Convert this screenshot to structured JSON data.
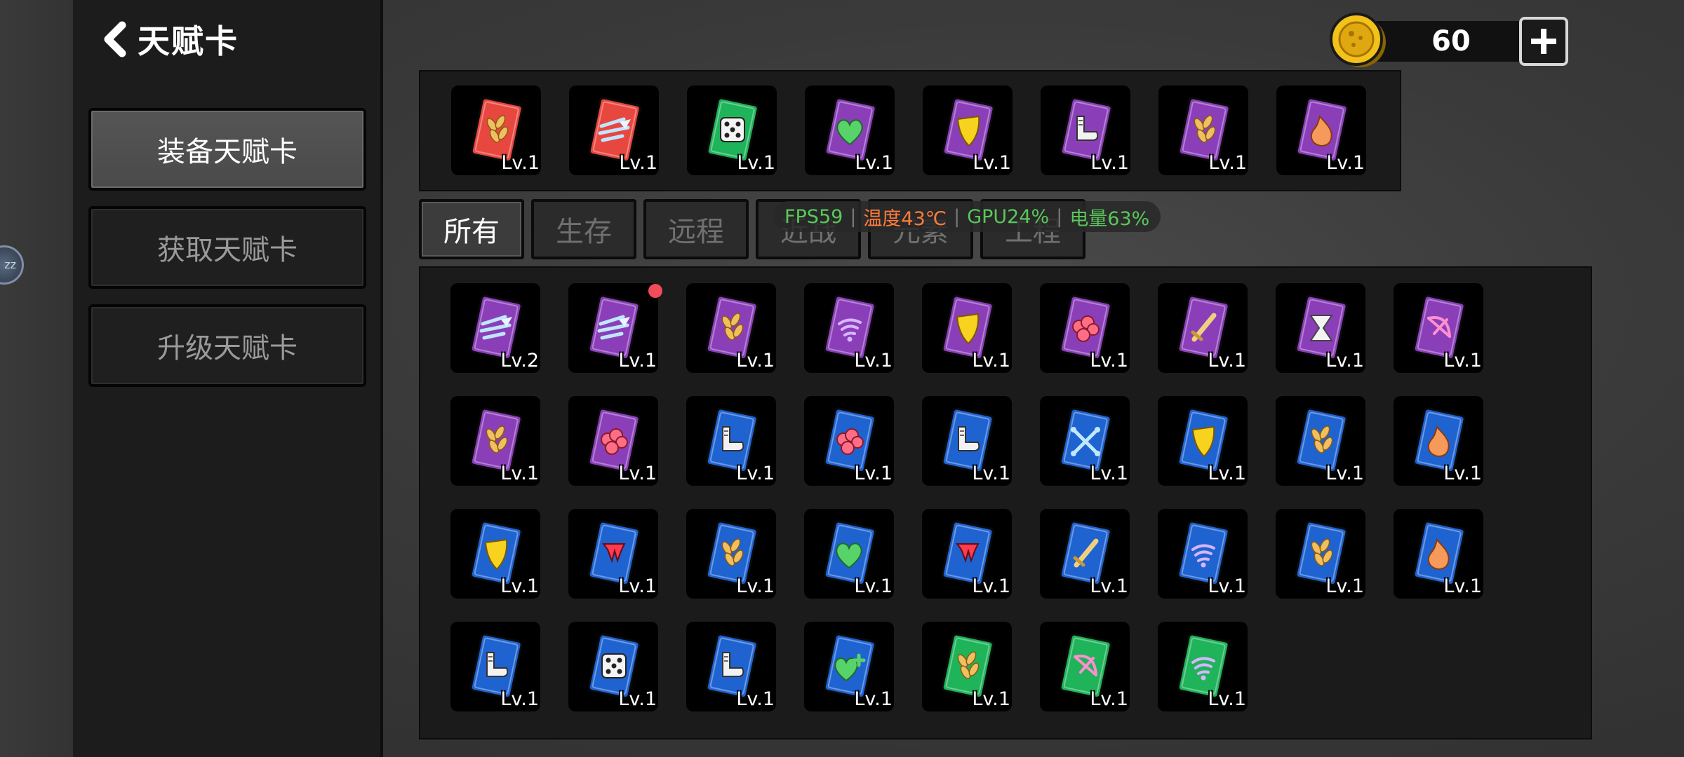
{
  "header": {
    "title": "天赋卡"
  },
  "sidebar": {
    "items": [
      {
        "label": "装备天赋卡",
        "active": true
      },
      {
        "label": "获取天赋卡",
        "active": false
      },
      {
        "label": "升级天赋卡",
        "active": false
      }
    ]
  },
  "floating_ball": {
    "label": "zz"
  },
  "currency": {
    "value": "60"
  },
  "tabs": [
    {
      "label": "所有",
      "active": true
    },
    {
      "label": "生存",
      "active": false
    },
    {
      "label": "远程",
      "active": false
    },
    {
      "label": "近战",
      "active": false
    },
    {
      "label": "元素",
      "active": false
    },
    {
      "label": "工程",
      "active": false
    }
  ],
  "overlay": {
    "fps": "FPS59",
    "temp": "温度43℃",
    "gpu": "GPU24%",
    "battery": "电量63%"
  },
  "colors": {
    "red": "#e8473f",
    "green": "#1fb35a",
    "purple": "#8a3fb8",
    "blue": "#1f63d1",
    "fps_green": "#59c85a",
    "temp_orange": "#ff7b3b"
  },
  "equipped": [
    {
      "color": "red",
      "icon": "wheat-icon",
      "level": "Lv.1"
    },
    {
      "color": "red",
      "icon": "wind-icon",
      "level": "Lv.1"
    },
    {
      "color": "green",
      "icon": "dice-icon",
      "level": "Lv.1"
    },
    {
      "color": "purple",
      "icon": "heart-icon",
      "level": "Lv.1"
    },
    {
      "color": "purple",
      "icon": "shield-icon",
      "level": "Lv.1"
    },
    {
      "color": "purple",
      "icon": "boot-icon",
      "level": "Lv.1"
    },
    {
      "color": "purple",
      "icon": "wheat-icon",
      "level": "Lv.1"
    },
    {
      "color": "purple",
      "icon": "fire-icon",
      "level": "Lv.1"
    }
  ],
  "inventory": [
    {
      "color": "purple",
      "icon": "wind-icon",
      "level": "Lv.2"
    },
    {
      "color": "purple",
      "icon": "wind-icon",
      "level": "Lv.1",
      "new": true
    },
    {
      "color": "purple",
      "icon": "wheat-icon",
      "level": "Lv.1"
    },
    {
      "color": "purple",
      "icon": "signal-icon",
      "level": "Lv.1"
    },
    {
      "color": "purple",
      "icon": "shield-icon",
      "level": "Lv.1"
    },
    {
      "color": "purple",
      "icon": "fist-icon",
      "level": "Lv.1"
    },
    {
      "color": "purple",
      "icon": "sword-icon",
      "level": "Lv.1"
    },
    {
      "color": "purple",
      "icon": "hourglass-icon",
      "level": "Lv.1"
    },
    {
      "color": "purple",
      "icon": "bow-icon",
      "level": "Lv.1"
    },
    {
      "color": "purple",
      "icon": "wheat-icon",
      "level": "Lv.1"
    },
    {
      "color": "purple",
      "icon": "fist-icon",
      "level": "Lv.1"
    },
    {
      "color": "blue",
      "icon": "boot-icon",
      "level": "Lv.1"
    },
    {
      "color": "blue",
      "icon": "fist-icon",
      "level": "Lv.1"
    },
    {
      "color": "blue",
      "icon": "boot-icon",
      "level": "Lv.1"
    },
    {
      "color": "blue",
      "icon": "crossed-bones-icon",
      "level": "Lv.1"
    },
    {
      "color": "blue",
      "icon": "shield-icon",
      "level": "Lv.1"
    },
    {
      "color": "blue",
      "icon": "wheat-icon",
      "level": "Lv.1"
    },
    {
      "color": "blue",
      "icon": "fire-icon",
      "level": "Lv.1"
    },
    {
      "color": "blue",
      "icon": "shield-icon",
      "level": "Lv.1"
    },
    {
      "color": "blue",
      "icon": "fang-icon",
      "level": "Lv.1"
    },
    {
      "color": "blue",
      "icon": "wheat-icon",
      "level": "Lv.1"
    },
    {
      "color": "blue",
      "icon": "heart-icon",
      "level": "Lv.1"
    },
    {
      "color": "blue",
      "icon": "fang-icon",
      "level": "Lv.1"
    },
    {
      "color": "blue",
      "icon": "sword-icon",
      "level": "Lv.1"
    },
    {
      "color": "blue",
      "icon": "signal-icon",
      "level": "Lv.1"
    },
    {
      "color": "blue",
      "icon": "wheat-icon",
      "level": "Lv.1"
    },
    {
      "color": "blue",
      "icon": "fire-icon",
      "level": "Lv.1"
    },
    {
      "color": "blue",
      "icon": "boot-icon",
      "level": "Lv.1"
    },
    {
      "color": "blue",
      "icon": "dice-icon",
      "level": "Lv.1"
    },
    {
      "color": "blue",
      "icon": "boot-icon",
      "level": "Lv.1"
    },
    {
      "color": "blue",
      "icon": "heart-plus-icon",
      "level": "Lv.1"
    },
    {
      "color": "green",
      "icon": "wheat-icon",
      "level": "Lv.1"
    },
    {
      "color": "green",
      "icon": "bow-icon",
      "level": "Lv.1"
    },
    {
      "color": "green",
      "icon": "signal-icon",
      "level": "Lv.1"
    }
  ]
}
